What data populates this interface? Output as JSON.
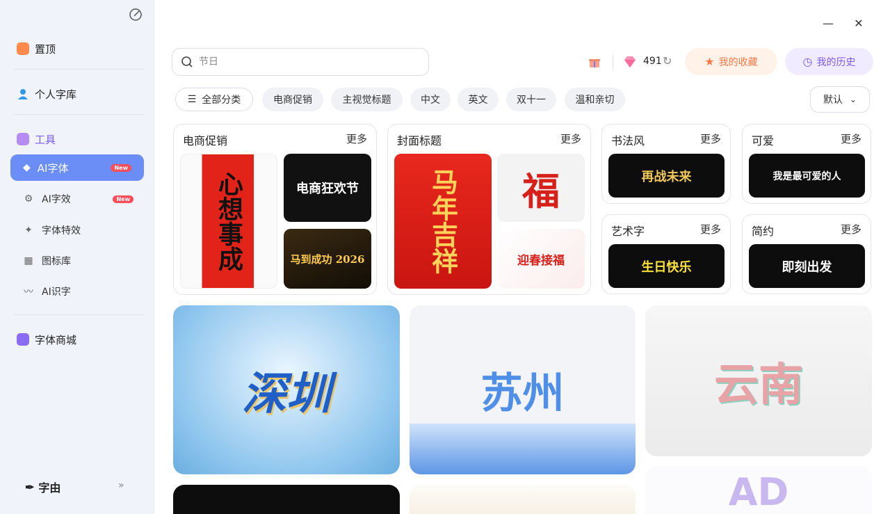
{
  "sidebar": {
    "pinned": "置顶",
    "personal_library": "个人字库",
    "tools_header": "工具",
    "tools": [
      {
        "label": "AI字体",
        "badge": "New"
      },
      {
        "label": "AI字效",
        "badge": "New"
      },
      {
        "label": "字体特效"
      },
      {
        "label": "图标库"
      },
      {
        "label": "AI识字"
      }
    ],
    "font_store": "字体商城",
    "brand": "字由",
    "expand": "»"
  },
  "window": {
    "minimize": "—",
    "close": "✕"
  },
  "search": {
    "placeholder": "节日"
  },
  "header": {
    "credits": "491",
    "favorites_label": "我的收藏",
    "history_label": "我的历史"
  },
  "filters": {
    "chips": [
      "全部分类",
      "电商促销",
      "主视觉标题",
      "中文",
      "英文",
      "双十一",
      "温和亲切"
    ],
    "sort": "默认"
  },
  "categories": [
    {
      "title": "电商促销",
      "more": "更多",
      "samples": [
        "心想事成",
        "电商狂欢节",
        "马到成功 2026"
      ]
    },
    {
      "title": "封面标题",
      "more": "更多",
      "samples": [
        "马年吉祥",
        "福",
        "迎春接福"
      ]
    },
    {
      "title": "书法风",
      "more": "更多",
      "samples": [
        "再战未来"
      ]
    },
    {
      "title": "可爱",
      "more": "更多",
      "samples": [
        "我是最可爱的人"
      ]
    },
    {
      "title": "艺术字",
      "more": "更多",
      "samples": [
        "生日快乐"
      ]
    },
    {
      "title": "简约",
      "more": "更多",
      "samples": [
        "即刻出发"
      ]
    }
  ],
  "showcase": [
    "深圳",
    "苏州",
    "云南",
    "AD"
  ],
  "colors": {
    "accent": "#6a8ef5",
    "badge": "#ff4d5a",
    "fav": "#ff7a45",
    "history": "#7a5af8"
  }
}
